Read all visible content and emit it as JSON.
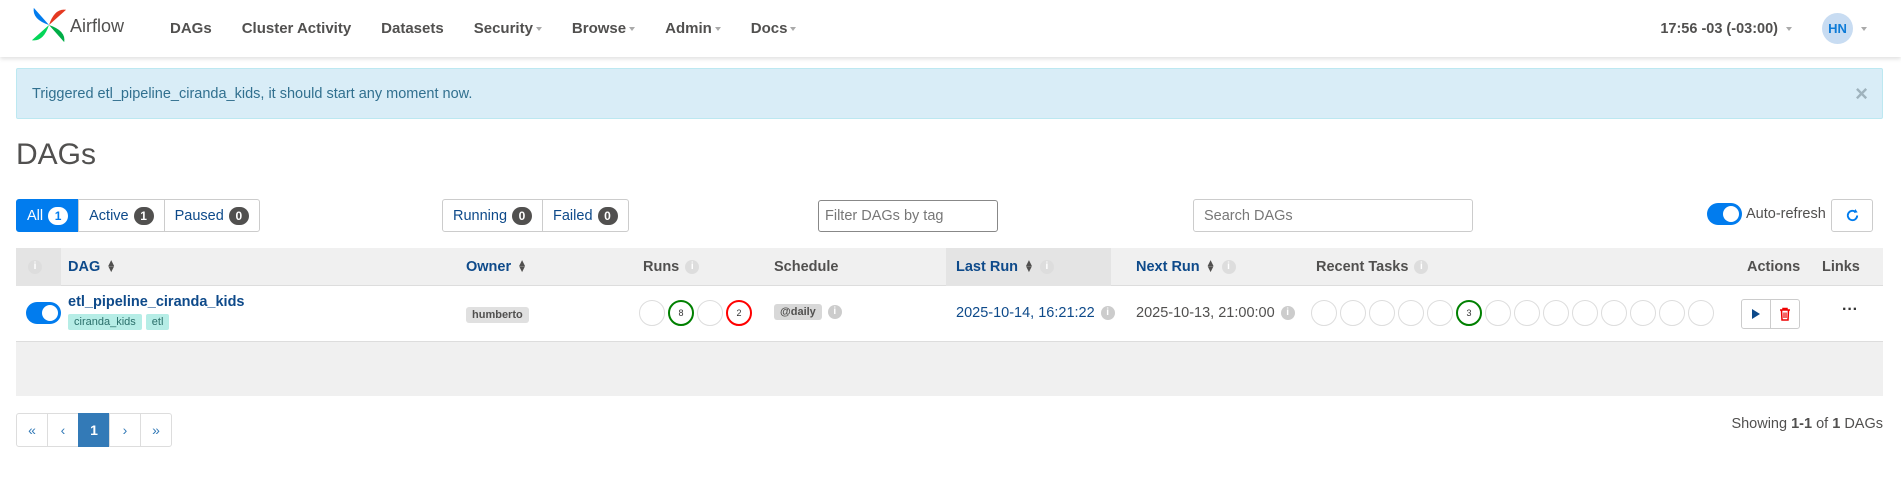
{
  "navbar": {
    "brand": "Airflow",
    "items": [
      {
        "label": "DAGs",
        "dropdown": false
      },
      {
        "label": "Cluster Activity",
        "dropdown": false
      },
      {
        "label": "Datasets",
        "dropdown": false
      },
      {
        "label": "Security",
        "dropdown": true
      },
      {
        "label": "Browse",
        "dropdown": true
      },
      {
        "label": "Admin",
        "dropdown": true
      },
      {
        "label": "Docs",
        "dropdown": true
      }
    ],
    "clock": "17:56 -03 (-03:00)",
    "user_initials": "HN"
  },
  "alert": {
    "message": "Triggered etl_pipeline_ciranda_kids, it should start any moment now.",
    "close": "×"
  },
  "page_title": "DAGs",
  "filters": {
    "status": [
      {
        "label": "All",
        "count": "1",
        "active": true
      },
      {
        "label": "Active",
        "count": "1",
        "active": false
      },
      {
        "label": "Paused",
        "count": "0",
        "active": false
      }
    ],
    "runs": [
      {
        "label": "Running",
        "count": "0"
      },
      {
        "label": "Failed",
        "count": "0"
      }
    ],
    "tag_placeholder": "Filter DAGs by tag",
    "search_placeholder": "Search DAGs",
    "auto_refresh_label": "Auto-refresh",
    "auto_refresh_on": true
  },
  "table": {
    "headers": {
      "dag": "DAG",
      "owner": "Owner",
      "runs": "Runs",
      "schedule": "Schedule",
      "last_run": "Last Run",
      "next_run": "Next Run",
      "recent_tasks": "Recent Tasks",
      "actions": "Actions",
      "links": "Links"
    },
    "rows": [
      {
        "enabled": true,
        "dag_id": "etl_pipeline_ciranda_kids",
        "tags": [
          "ciranda_kids",
          "etl"
        ],
        "owner": "humberto",
        "runs": [
          {
            "count": "",
            "state": "none"
          },
          {
            "count": "8",
            "state": "success"
          },
          {
            "count": "",
            "state": "none"
          },
          {
            "count": "2",
            "state": "failed"
          }
        ],
        "schedule": "@daily",
        "last_run": "2025-10-14, 16:21:22",
        "next_run": "2025-10-13, 21:00:00",
        "recent_tasks": [
          {
            "count": "",
            "state": "none"
          },
          {
            "count": "",
            "state": "none"
          },
          {
            "count": "",
            "state": "none"
          },
          {
            "count": "",
            "state": "none"
          },
          {
            "count": "",
            "state": "none"
          },
          {
            "count": "3",
            "state": "success"
          },
          {
            "count": "",
            "state": "none"
          },
          {
            "count": "",
            "state": "none"
          },
          {
            "count": "",
            "state": "none"
          },
          {
            "count": "",
            "state": "none"
          },
          {
            "count": "",
            "state": "none"
          },
          {
            "count": "",
            "state": "none"
          },
          {
            "count": "",
            "state": "none"
          },
          {
            "count": "",
            "state": "none"
          }
        ],
        "links_label": "···"
      }
    ]
  },
  "pagination": {
    "first": "«",
    "prev": "‹",
    "current": "1",
    "next": "›",
    "last": "»"
  },
  "footer": {
    "showing_prefix": "Showing ",
    "range": "1-1",
    "of": " of ",
    "total": "1",
    "suffix": " DAGs"
  },
  "colors": {
    "primary": "#017cee",
    "success": "#008000",
    "failed": "#ff0000",
    "link": "#0e4a8a",
    "alert_bg": "#d9edf7"
  }
}
